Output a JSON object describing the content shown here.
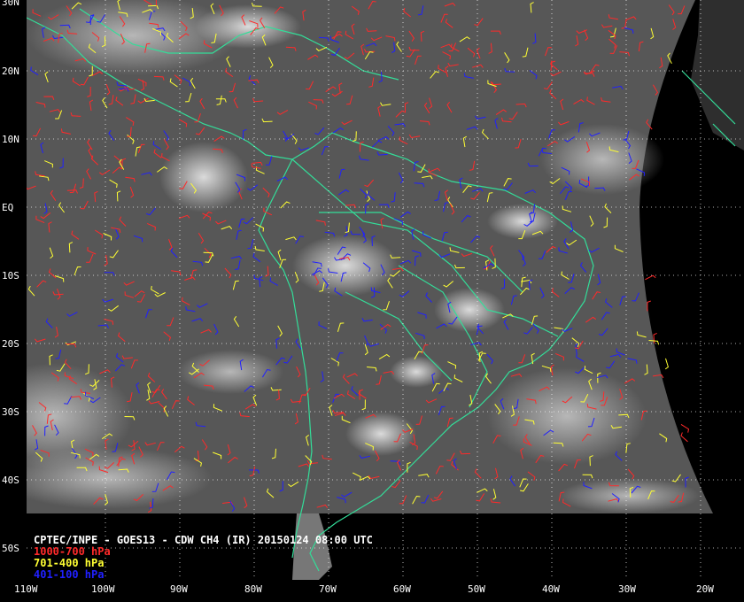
{
  "title": "CPTEC/INPE - GOES13 - CDW CH4 (IR) 20150124 08:00 UTC",
  "legend": [
    {
      "label": "1000-700 hPa",
      "color": "#ff2a2a"
    },
    {
      "label": "701-400 hPa",
      "color": "#ffff33"
    },
    {
      "label": "401-100 hPa",
      "color": "#2020ff"
    }
  ],
  "lat_labels": [
    "30N",
    "20N",
    "10N",
    "EQ",
    "10S",
    "20S",
    "30S",
    "40S",
    "50S"
  ],
  "lon_labels": [
    "110W",
    "100W",
    "90W",
    "80W",
    "70W",
    "60W",
    "50W",
    "40W",
    "30W",
    "20W"
  ],
  "colors": {
    "coastline": "#33dd99",
    "grid": "#ffffff",
    "background": "#000000"
  }
}
